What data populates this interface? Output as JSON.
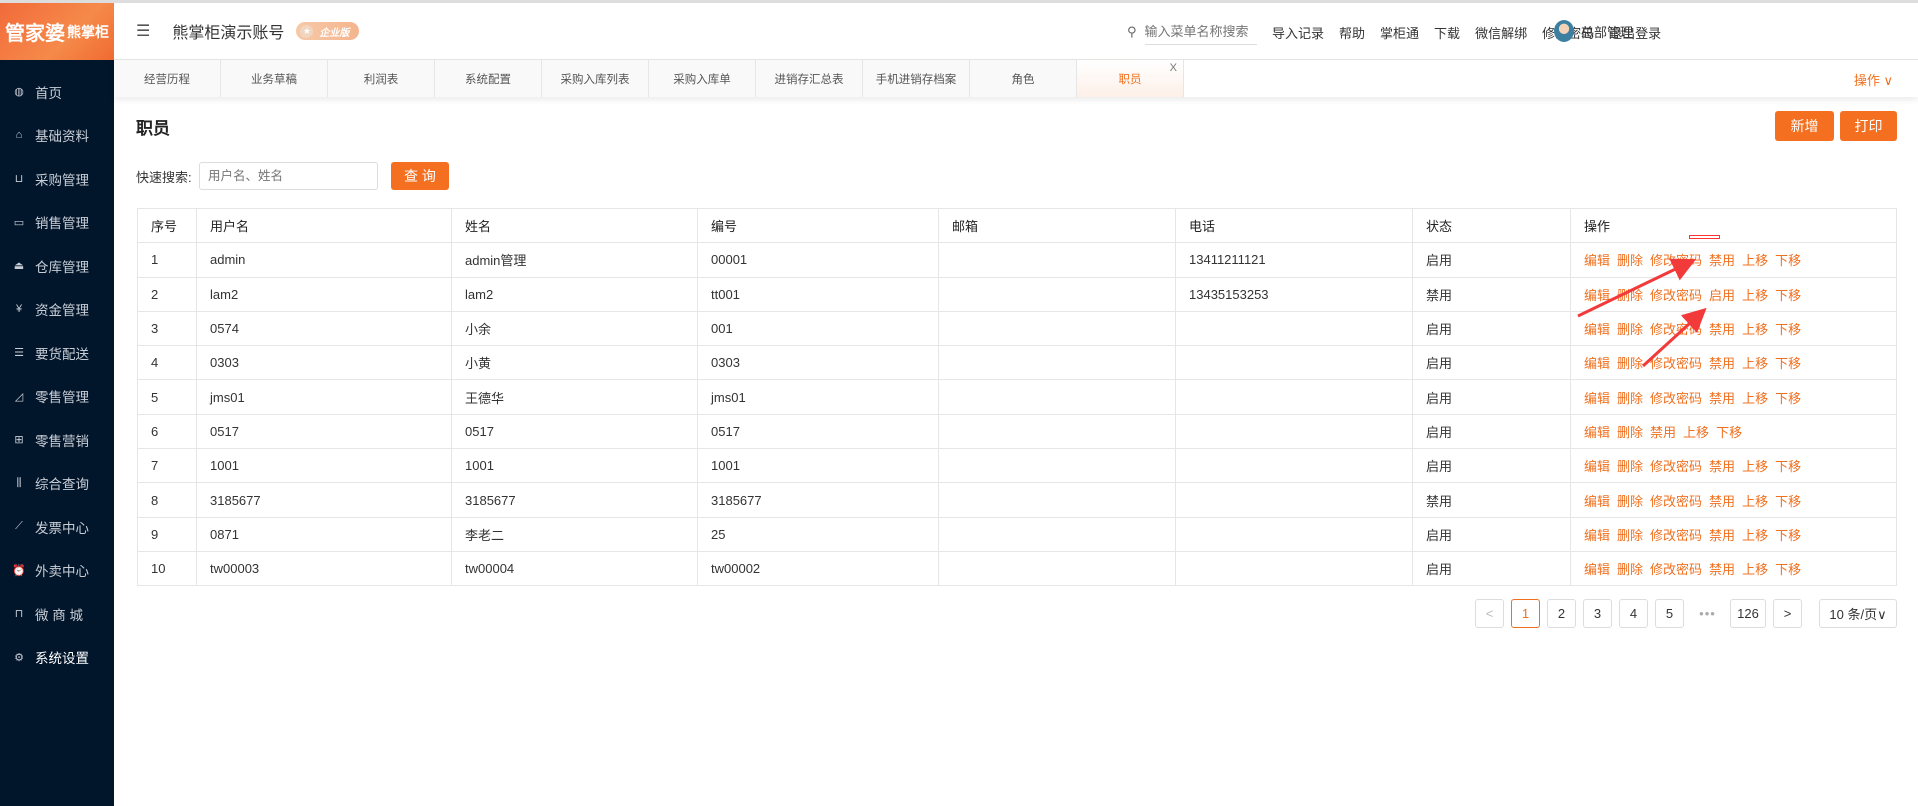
{
  "logo": {
    "main": "管家婆",
    "sub": "熊掌柜"
  },
  "sidebar": {
    "items": [
      {
        "label": "首页",
        "icon": "globe-icon",
        "glyph": "◍"
      },
      {
        "label": "基础资料",
        "icon": "home-icon",
        "glyph": "⌂"
      },
      {
        "label": "采购管理",
        "icon": "cart-icon",
        "glyph": "⊔"
      },
      {
        "label": "销售管理",
        "icon": "register-icon",
        "glyph": "▭"
      },
      {
        "label": "仓库管理",
        "icon": "bank-icon",
        "glyph": "⏏"
      },
      {
        "label": "资金管理",
        "icon": "money-icon",
        "glyph": "¥"
      },
      {
        "label": "要货配送",
        "icon": "list-icon",
        "glyph": "☰"
      },
      {
        "label": "零售管理",
        "icon": "area-chart-icon",
        "glyph": "◿"
      },
      {
        "label": "零售营销",
        "icon": "gift-icon",
        "glyph": "⊞"
      },
      {
        "label": "综合查询",
        "icon": "bar-chart-icon",
        "glyph": "⫼"
      },
      {
        "label": "发票中心",
        "icon": "line-chart-icon",
        "glyph": "⟋"
      },
      {
        "label": "外卖中心",
        "icon": "alarm-icon",
        "glyph": "⏰"
      },
      {
        "label": "微 商 城",
        "icon": "bag-icon",
        "glyph": "⊓"
      },
      {
        "label": "系统设置",
        "icon": "gear-icon",
        "glyph": "⚙"
      }
    ],
    "active": 13
  },
  "header": {
    "account": "熊掌柜演示账号",
    "edition": "企业版",
    "search_placeholder": "输入菜单名称搜索",
    "links": [
      "导入记录",
      "帮助",
      "掌柜通",
      "下载",
      "微信解绑",
      "修改密码",
      "退出登录"
    ],
    "user": "总部管理"
  },
  "tabs": {
    "items": [
      "经营历程",
      "业务草稿",
      "利润表",
      "系统配置",
      "采购入库列表",
      "采购入库单",
      "进销存汇总表",
      "手机进销存档案",
      "角色",
      "职员"
    ],
    "active": 9,
    "close": "X",
    "ops": "操作 ∨"
  },
  "page": {
    "title": "职员",
    "add": "新增",
    "print": "打印",
    "search_label": "快速搜索:",
    "search_placeholder": "用户名、姓名",
    "query": "查 询"
  },
  "table": {
    "columns": [
      "序号",
      "用户名",
      "姓名",
      "编号",
      "邮箱",
      "电话",
      "状态",
      "操作"
    ],
    "rows": [
      {
        "no": "1",
        "username": "admin",
        "name": "admin管理",
        "code": "00001",
        "email": "",
        "phone": "13411211121",
        "status": "启用",
        "actions": [
          "编辑",
          "删除",
          "修改密码",
          "禁用",
          "上移",
          "下移"
        ]
      },
      {
        "no": "2",
        "username": "lam2",
        "name": "lam2",
        "code": "tt001",
        "email": "",
        "phone": "13435153253",
        "status": "禁用",
        "actions": [
          "编辑",
          "删除",
          "修改密码",
          "启用",
          "上移",
          "下移"
        ]
      },
      {
        "no": "3",
        "username": "0574",
        "name": "小余",
        "code": "001",
        "email": "",
        "phone": "",
        "status": "启用",
        "actions": [
          "编辑",
          "删除",
          "修改密码",
          "禁用",
          "上移",
          "下移"
        ]
      },
      {
        "no": "4",
        "username": "0303",
        "name": "小黄",
        "code": "0303",
        "email": "",
        "phone": "",
        "status": "启用",
        "actions": [
          "编辑",
          "删除",
          "修改密码",
          "禁用",
          "上移",
          "下移"
        ]
      },
      {
        "no": "5",
        "username": "jms01",
        "name": "王德华",
        "code": "jms01",
        "email": "",
        "phone": "",
        "status": "启用",
        "actions": [
          "编辑",
          "删除",
          "修改密码",
          "禁用",
          "上移",
          "下移"
        ]
      },
      {
        "no": "6",
        "username": "0517",
        "name": "0517",
        "code": "0517",
        "email": "",
        "phone": "",
        "status": "启用",
        "actions": [
          "编辑",
          "删除",
          "禁用",
          "上移",
          "下移"
        ]
      },
      {
        "no": "7",
        "username": "1001",
        "name": "1001",
        "code": "1001",
        "email": "",
        "phone": "",
        "status": "启用",
        "actions": [
          "编辑",
          "删除",
          "修改密码",
          "禁用",
          "上移",
          "下移"
        ]
      },
      {
        "no": "8",
        "username": "3185677",
        "name": "3185677",
        "code": "3185677",
        "email": "",
        "phone": "",
        "status": "禁用",
        "actions": [
          "编辑",
          "删除",
          "修改密码",
          "禁用",
          "上移",
          "下移"
        ]
      },
      {
        "no": "9",
        "username": "0871",
        "name": "李老二",
        "code": "25",
        "email": "",
        "phone": "",
        "status": "启用",
        "actions": [
          "编辑",
          "删除",
          "修改密码",
          "禁用",
          "上移",
          "下移"
        ]
      },
      {
        "no": "10",
        "username": "tw00003",
        "name": "tw00004",
        "code": "tw00002",
        "email": "",
        "phone": "",
        "status": "启用",
        "actions": [
          "编辑",
          "删除",
          "修改密码",
          "禁用",
          "上移",
          "下移"
        ]
      }
    ]
  },
  "pagination": {
    "prev": "<",
    "pages": [
      "1",
      "2",
      "3",
      "4",
      "5"
    ],
    "ellipsis": "•••",
    "last": "126",
    "next": ">",
    "current": "1",
    "page_size": "10 条/页∨"
  },
  "colors": {
    "accent": "#f47020",
    "sidebar": "#01152b",
    "annotation": "#f33a3a"
  }
}
